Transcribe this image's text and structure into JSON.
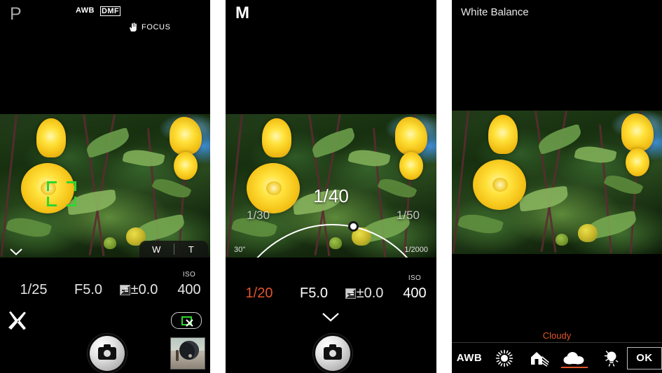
{
  "panels": [
    {
      "id": "program-mode",
      "mode_letter": "P",
      "wb_tag": "AWB",
      "focus_mode_tag": "DMF",
      "focus_label": "FOCUS",
      "focus_icon": "hand-pointer-icon",
      "af_frame_icon": "af-bracket-icon",
      "zoom_control": {
        "wide_label": "W",
        "tele_label": "T"
      },
      "collapse_icon": "chevron-down-icon",
      "readout": {
        "shutter": "1/25",
        "aperture": "F5.0",
        "exposure_comp": "±0.0",
        "exposure_comp_icon": "exposure-compensation-icon",
        "iso_caption": "ISO",
        "iso": "400"
      },
      "tools_icon": "wrench-screwdriver-icon",
      "shutter_button_icon": "camera-icon",
      "record_badge_icon": "movie-disabled-icon",
      "thumbnail_icon": "last-photo-thumbnail"
    },
    {
      "id": "manual-mode",
      "mode_letter": "M",
      "dial": {
        "selected_value": "1/40",
        "left_value": "1/30",
        "right_value": "1/50",
        "knob_icon": "slider-knob-icon",
        "range_min": "30\"",
        "range_max": "1/2000"
      },
      "readout": {
        "shutter": "1/20",
        "aperture": "F5.0",
        "exposure_comp": "±0.0",
        "exposure_comp_icon": "exposure-compensation-icon",
        "iso_caption": "ISO",
        "iso": "400"
      },
      "collapse_icon": "chevron-down-icon",
      "shutter_button_icon": "camera-icon"
    },
    {
      "id": "white-balance",
      "title": "White Balance",
      "selected_label": "Cloudy",
      "options": [
        {
          "label": "AWB",
          "icon": "awb-text-icon",
          "selected": false
        },
        {
          "label": "Daylight",
          "icon": "sun-icon",
          "selected": false
        },
        {
          "label": "Shade",
          "icon": "house-shade-icon",
          "selected": false
        },
        {
          "label": "Cloudy",
          "icon": "cloud-icon",
          "selected": true
        },
        {
          "label": "Incandescent",
          "icon": "light-bulb-icon",
          "selected": false
        }
      ],
      "ok_label": "OK"
    }
  ],
  "colors": {
    "accent": "#e2552a",
    "af_green": "#2fd62f",
    "text_primary": "#ffffff",
    "text_secondary": "#a8a8a8",
    "background": "#000000"
  }
}
